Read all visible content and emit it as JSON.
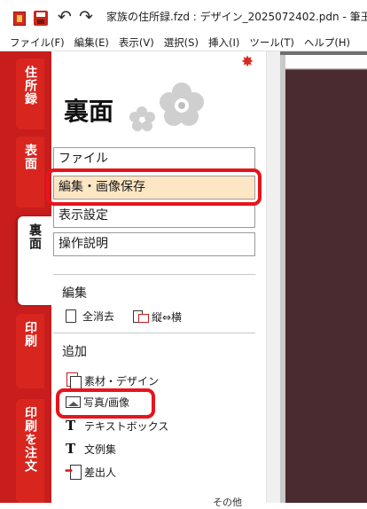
{
  "window": {
    "title": "家族の住所録.fzd : デザイン_2025072402.pdn - 筆王"
  },
  "menubar": {
    "items": [
      "ファイル(F)",
      "編集(E)",
      "表示(V)",
      "選択(S)",
      "挿入(I)",
      "ツール(T)",
      "ヘルプ(H)"
    ]
  },
  "tabs": [
    {
      "label": "住所録",
      "active": false
    },
    {
      "label": "表面",
      "active": false
    },
    {
      "label": "裏面",
      "active": true
    },
    {
      "label": "印刷",
      "active": false
    },
    {
      "label": "印刷を注文",
      "active": false
    }
  ],
  "panel": {
    "title": "裏面",
    "menu": [
      "ファイル",
      "編集・画像保存",
      "表示設定",
      "操作説明"
    ],
    "selected_menu": "編集・画像保存",
    "edit_section": {
      "label": "編集",
      "clear_all": "全消去",
      "rotate": "縦⇔横"
    },
    "add_section": {
      "label": "追加",
      "items": [
        "素材・デザイン",
        "写真/画像",
        "テキストボックス",
        "文例集",
        "差出人"
      ]
    },
    "more_label": "その他"
  },
  "colors": {
    "accent_red": "#c81d1d",
    "highlight_red": "#e8141b",
    "selected_bg": "#fde6c4",
    "canvas_card": "#4a2b2f"
  }
}
